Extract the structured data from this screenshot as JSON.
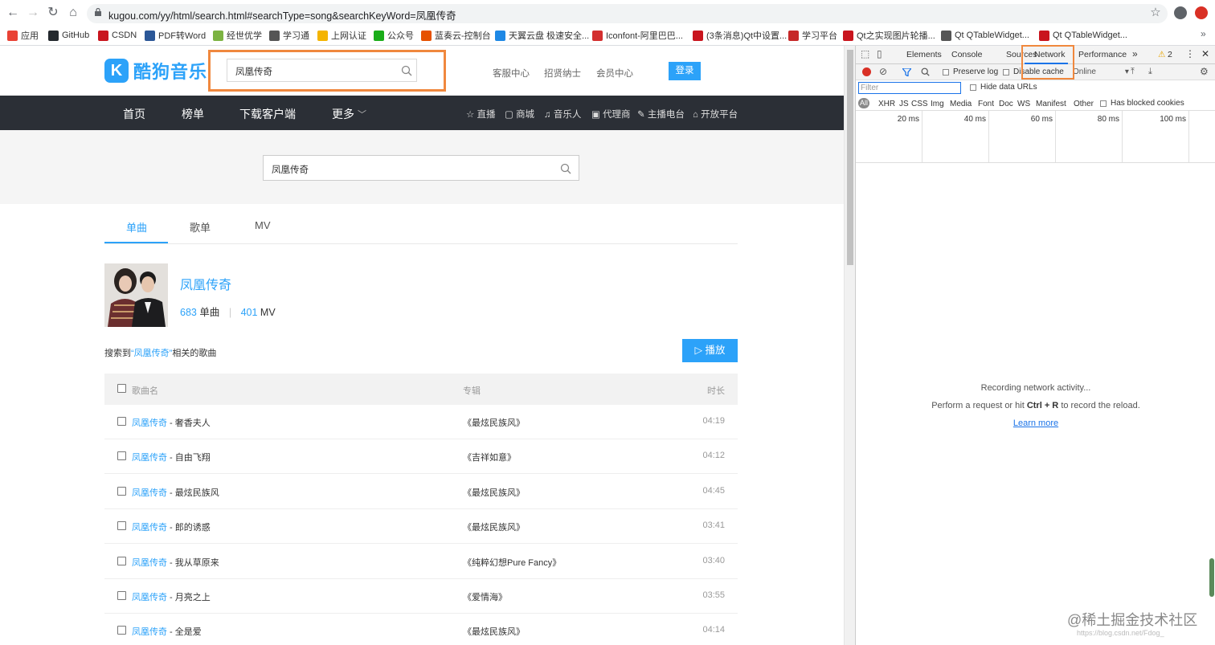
{
  "browser": {
    "url": "kugou.com/yy/html/search.html#searchType=song&searchKeyWord=凤凰传奇",
    "bookmarks": [
      {
        "label": "应用",
        "color": "#e94235"
      },
      {
        "label": "GitHub",
        "color": "#24292e"
      },
      {
        "label": "CSDN",
        "color": "#c9151e"
      },
      {
        "label": "PDF转Word",
        "color": "#2b5797"
      },
      {
        "label": "经世优学",
        "color": "#7cb342"
      },
      {
        "label": "学习通",
        "color": "#555555"
      },
      {
        "label": "上网认证",
        "color": "#f4b400"
      },
      {
        "label": "公众号",
        "color": "#1aad19"
      },
      {
        "label": "蓝奏云-控制台",
        "color": "#e65100"
      },
      {
        "label": "天翼云盘 极速安全...",
        "color": "#1e88e5"
      },
      {
        "label": "Iconfont-阿里巴巴...",
        "color": "#d32f2f"
      },
      {
        "label": "(3条消息)Qt中设置...",
        "color": "#c9151e"
      },
      {
        "label": "学习平台",
        "color": "#c62828"
      },
      {
        "label": "Qt之实现图片轮播...",
        "color": "#c9151e"
      },
      {
        "label": "Qt QTableWidget...",
        "color": "#555555"
      },
      {
        "label": "Qt QTableWidget...",
        "color": "#c9151e"
      }
    ]
  },
  "site": {
    "logo_letter": "K",
    "logo_text": "酷狗音乐",
    "top_search_value": "凤凰传奇",
    "header_links": [
      "客服中心",
      "招贤纳士",
      "会员中心"
    ],
    "login_label": "登录",
    "nav_main": [
      "首页",
      "榜单",
      "下载客户端",
      "更多"
    ],
    "nav_sub": [
      "直播",
      "商城",
      "音乐人",
      "代理商",
      "主播电台",
      "开放平台"
    ],
    "big_search_value": "凤凰传奇",
    "tabs": [
      "单曲",
      "歌单",
      "MV"
    ],
    "artist": {
      "name": "凤凰传奇",
      "songs_count": "683",
      "songs_label": "单曲",
      "mv_count": "401",
      "mv_label": "MV"
    },
    "search_desc_prefix": "搜索到",
    "search_desc_keyword": "“凤凰传奇”",
    "search_desc_suffix": "相关的歌曲",
    "play_label": "播放",
    "table_headers": {
      "name": "歌曲名",
      "album": "专辑",
      "duration": "时长"
    },
    "songs": [
      {
        "artist": "凤凰传奇",
        "title": " - 奢香夫人",
        "album": "《最炫民族风》",
        "duration": "04:19"
      },
      {
        "artist": "凤凰传奇",
        "title": " - 自由飞翔",
        "album": "《吉祥如意》",
        "duration": "04:12"
      },
      {
        "artist": "凤凰传奇",
        "title": " - 最炫民族风",
        "album": "《最炫民族风》",
        "duration": "04:45"
      },
      {
        "artist": "凤凰传奇",
        "title": " - 郎的诱惑",
        "album": "《最炫民族风》",
        "duration": "03:41"
      },
      {
        "artist": "凤凰传奇",
        "title": " - 我从草原来",
        "album": "《纯粹幻想Pure Fancy》",
        "duration": "03:40"
      },
      {
        "artist": "凤凰传奇",
        "title": " - 月亮之上",
        "album": "《爱情海》",
        "duration": "03:55"
      },
      {
        "artist": "凤凰传奇",
        "title": " - 全是爱",
        "album": "《最炫民族风》",
        "duration": "04:14"
      }
    ]
  },
  "devtools": {
    "tabs": [
      "Elements",
      "Console",
      "Sources",
      "Network",
      "Performance"
    ],
    "warning_count": "2",
    "preserve_log": "Preserve log",
    "disable_cache": "Disable cache",
    "throttle": "Online",
    "filter_placeholder": "Filter",
    "hide_data_urls": "Hide data URLs",
    "type_all": "All",
    "types": [
      "XHR",
      "JS",
      "CSS",
      "Img",
      "Media",
      "Font",
      "Doc",
      "WS",
      "Manifest",
      "Other"
    ],
    "has_blocked": "Has blocked cookies",
    "timeline_ticks": [
      "20 ms",
      "40 ms",
      "60 ms",
      "80 ms",
      "100 ms"
    ],
    "msg_line1": "Recording network activity...",
    "msg_line2_prefix": "Perform a request or hit ",
    "msg_line2_keys": "Ctrl + R",
    "msg_line2_suffix": " to record the reload.",
    "learn_more": "Learn more"
  },
  "watermark": "@稀土掘金技术社区",
  "watermark_small": "https://blog.csdn.net/Fdog_"
}
